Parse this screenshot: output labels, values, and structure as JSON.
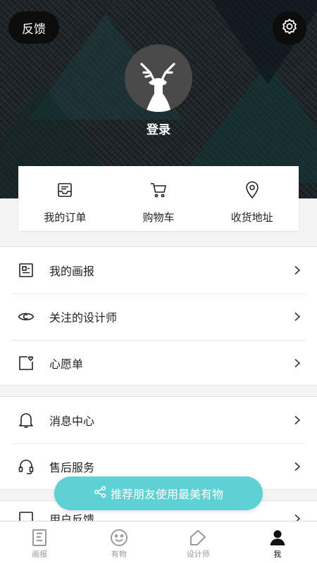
{
  "header": {
    "feedback_label": "反馈",
    "login_label": "登录",
    "settings_icon": "settings-gear-icon",
    "avatar_icon": "deer-avatar-icon"
  },
  "quick_actions": [
    {
      "label": "我的订单",
      "icon": "order-inbox-icon"
    },
    {
      "label": "购物车",
      "icon": "cart-icon"
    },
    {
      "label": "收货地址",
      "icon": "location-pin-icon"
    }
  ],
  "menu_group_1": [
    {
      "label": "我的画报",
      "icon": "document-icon"
    },
    {
      "label": "关注的设计师",
      "icon": "eye-icon"
    },
    {
      "label": "心愿单",
      "icon": "wishlist-heart-icon"
    }
  ],
  "menu_group_2": [
    {
      "label": "消息中心",
      "icon": "bell-icon"
    },
    {
      "label": "售后服务",
      "icon": "headset-icon"
    }
  ],
  "menu_group_3": [
    {
      "label": "用户反馈",
      "icon": "feedback-icon"
    }
  ],
  "share_button": {
    "label": "推荐朋友使用最美有物",
    "icon": "share-icon"
  },
  "tabbar": [
    {
      "label": "画报",
      "icon": "magazine-icon",
      "active": false
    },
    {
      "label": "有物",
      "icon": "smiley-icon",
      "active": false
    },
    {
      "label": "设计师",
      "icon": "pencil-house-icon",
      "active": false
    },
    {
      "label": "我",
      "icon": "person-icon",
      "active": true
    }
  ],
  "colors": {
    "accent": "#5fd0d4",
    "header_bg": "#1e2629",
    "inactive_tab": "#9a9a9a",
    "active_tab": "#111111"
  }
}
